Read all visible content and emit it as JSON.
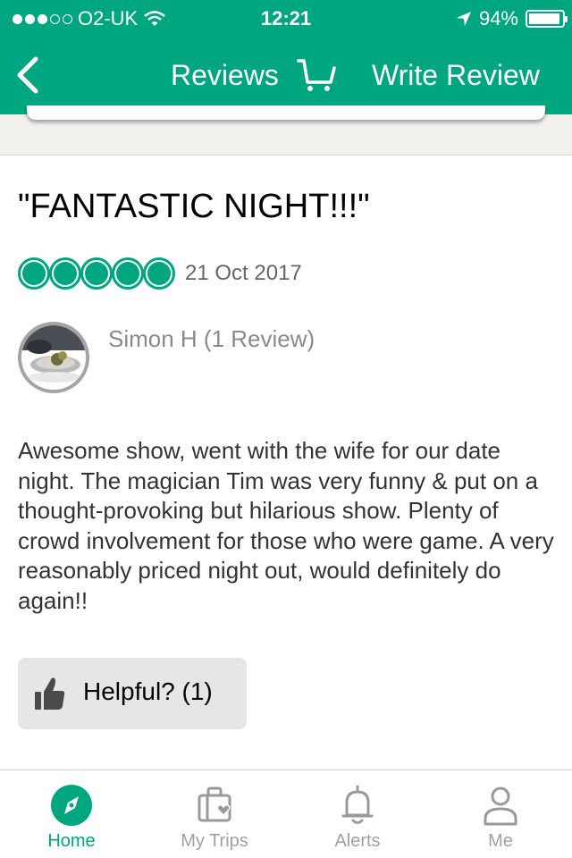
{
  "status_bar": {
    "carrier": "O2-UK",
    "time": "12:21",
    "battery": "94%",
    "battery_level": 0.94,
    "signal_bars_filled": 3,
    "signal_bars_total": 5
  },
  "nav": {
    "title": "Reviews",
    "write_review_label": "Write Review",
    "icons": [
      "back-chevron-icon",
      "cart-icon"
    ]
  },
  "review": {
    "title": "\"FANTASTIC NIGHT!!!\"",
    "rating": 5,
    "rating_max": 5,
    "date": "21 Oct 2017",
    "reviewer": "Simon H (1 Review)",
    "text": "Awesome show, went with the wife for our date night. The magician Tim was very funny & put on a thought-provoking but hilarious show. Plenty of crowd involvement for those who were game. A very reasonably priced night out, would definitely do again!!",
    "helpful_label": "Helpful? (1)"
  },
  "tab_bar": {
    "tabs": [
      {
        "label": "Home",
        "icon": "compass-icon",
        "active": true
      },
      {
        "label": "My Trips",
        "icon": "suitcase-heart-icon",
        "active": false
      },
      {
        "label": "Alerts",
        "icon": "bell-icon",
        "active": false
      },
      {
        "label": "Me",
        "icon": "person-icon",
        "active": false
      }
    ]
  },
  "colors": {
    "brand_green": "#00a680",
    "inactive_tab": "#a0a0a0",
    "button_bg": "#e6e6e6"
  }
}
